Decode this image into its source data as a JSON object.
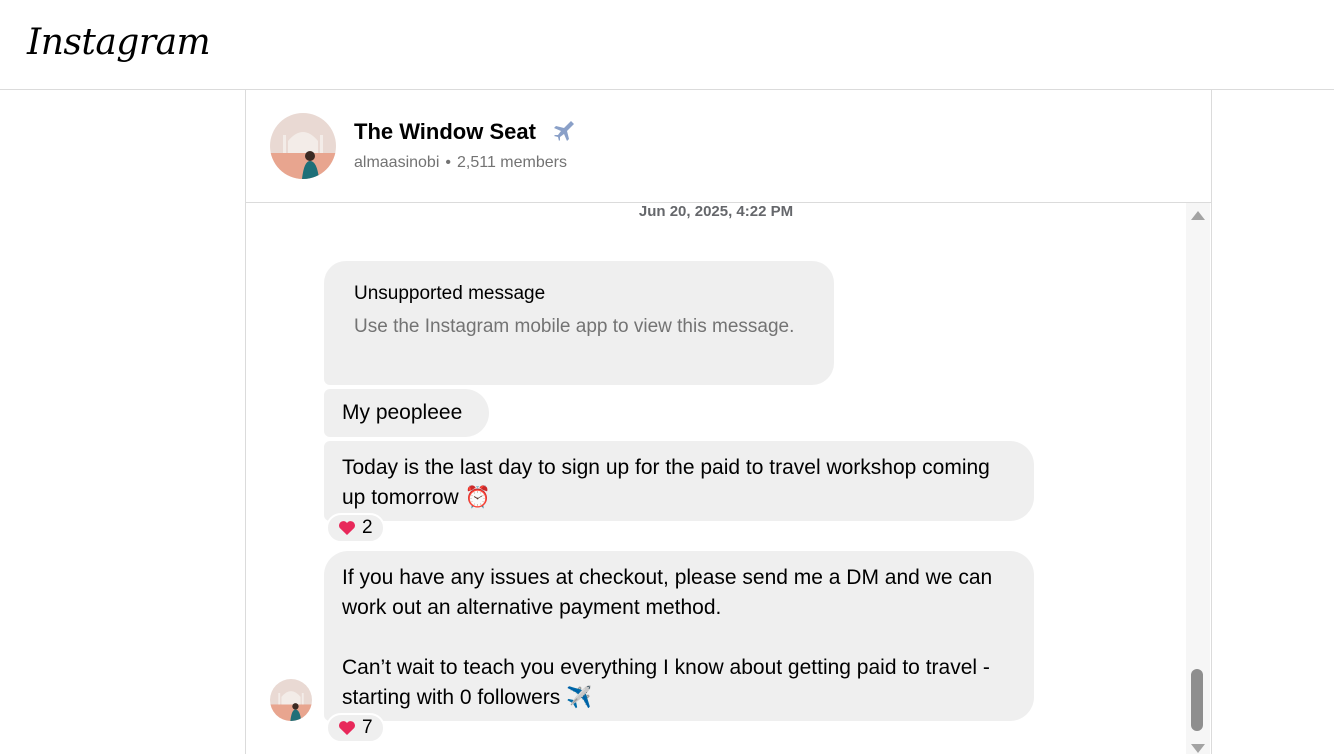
{
  "app": {
    "logo_text": "Instagram"
  },
  "chat": {
    "group_name": "The Window Seat",
    "group_emoji": "airplane-icon",
    "owner": "almaasinobi",
    "separator": "•",
    "members": "2,511 members"
  },
  "thread": {
    "timestamp": "Jun 20, 2025, 4:22 PM",
    "messages": [
      {
        "title": "Unsupported message",
        "subtitle": "Use the Instagram mobile app to view this message."
      },
      {
        "text": "My peopleee"
      },
      {
        "text": "Today is the last day to sign up for the paid to travel workshop coming up tomorrow",
        "emoji": "⏰",
        "reaction_count": "2"
      },
      {
        "text": "If you have any issues at checkout, please send me a DM and we can work out an alternative payment method.\n\nCan’t wait to teach you everything I know about getting paid to travel - starting with 0 followers",
        "emoji": "✈️",
        "reaction_count": "7"
      }
    ]
  },
  "colors": {
    "bubble": "#efefef",
    "muted_text": "#737373",
    "border": "#dbdbdb",
    "heart": "#e8285a"
  }
}
